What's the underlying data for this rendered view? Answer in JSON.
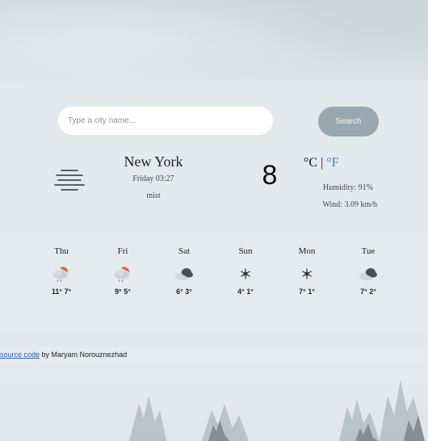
{
  "search": {
    "placeholder": "Type a city name...",
    "button_label": "Search"
  },
  "current": {
    "city": "New York",
    "datetime": "Friday 03:27",
    "description": "mist",
    "icon": "mist-icon",
    "temperature": "8",
    "unit_c": "°C",
    "unit_separator": "|",
    "unit_f": "°F",
    "humidity": "Humidity: 91%",
    "wind": "Wind: 3.09 km/h"
  },
  "forecast": [
    {
      "day": "Thu",
      "temps": "11° 7°",
      "icon": "rain-cloud-icon"
    },
    {
      "day": "Fri",
      "temps": "9° 5°",
      "icon": "rain-cloud-icon"
    },
    {
      "day": "Sat",
      "temps": "6° 3°",
      "icon": "cloudy-icon"
    },
    {
      "day": "Sun",
      "temps": "4° 1°",
      "icon": "snowflake-icon"
    },
    {
      "day": "Mon",
      "temps": "7° 1°",
      "icon": "snowflake-icon"
    },
    {
      "day": "Tue",
      "temps": "7° 2°",
      "icon": "cloudy-icon"
    }
  ],
  "footer": {
    "link_text": "source code",
    "credit_text": " by Maryam Norouznezhad"
  },
  "colors": {
    "search_button": "#97a8b0",
    "unit_active": "#3b7bd6",
    "sun_orange": "#d9653b",
    "cloud_dark": "#4a4f54"
  }
}
